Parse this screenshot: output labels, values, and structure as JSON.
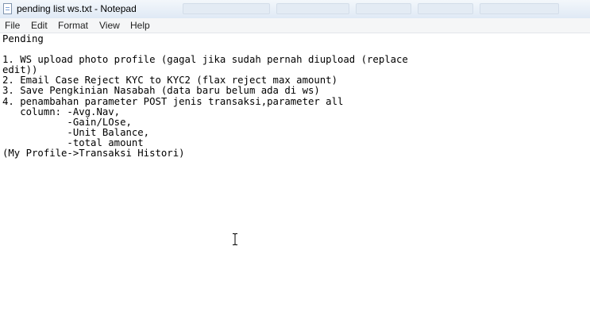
{
  "window": {
    "title": "pending list ws.txt - Notepad",
    "icon": "notepad-icon"
  },
  "menu": [
    "File",
    "Edit",
    "Format",
    "View",
    "Help"
  ],
  "editor": {
    "lines": [
      "Pending",
      "",
      "1. WS upload photo profile (gagal jika sudah pernah diupload (replace",
      "edit))",
      "2. Email Case Reject KYC to KYC2 (flax reject max amount)",
      "3. Save Pengkinian Nasabah (data baru belum ada di ws)",
      "4. penambahan parameter POST jenis transaksi,parameter all",
      "   column: -Avg.Nav,",
      "           -Gain/LOse,",
      "           -Unit Balance,",
      "           -total amount",
      "(My Profile->Transaksi Histori)"
    ],
    "cursor": "text-cursor-icon"
  }
}
